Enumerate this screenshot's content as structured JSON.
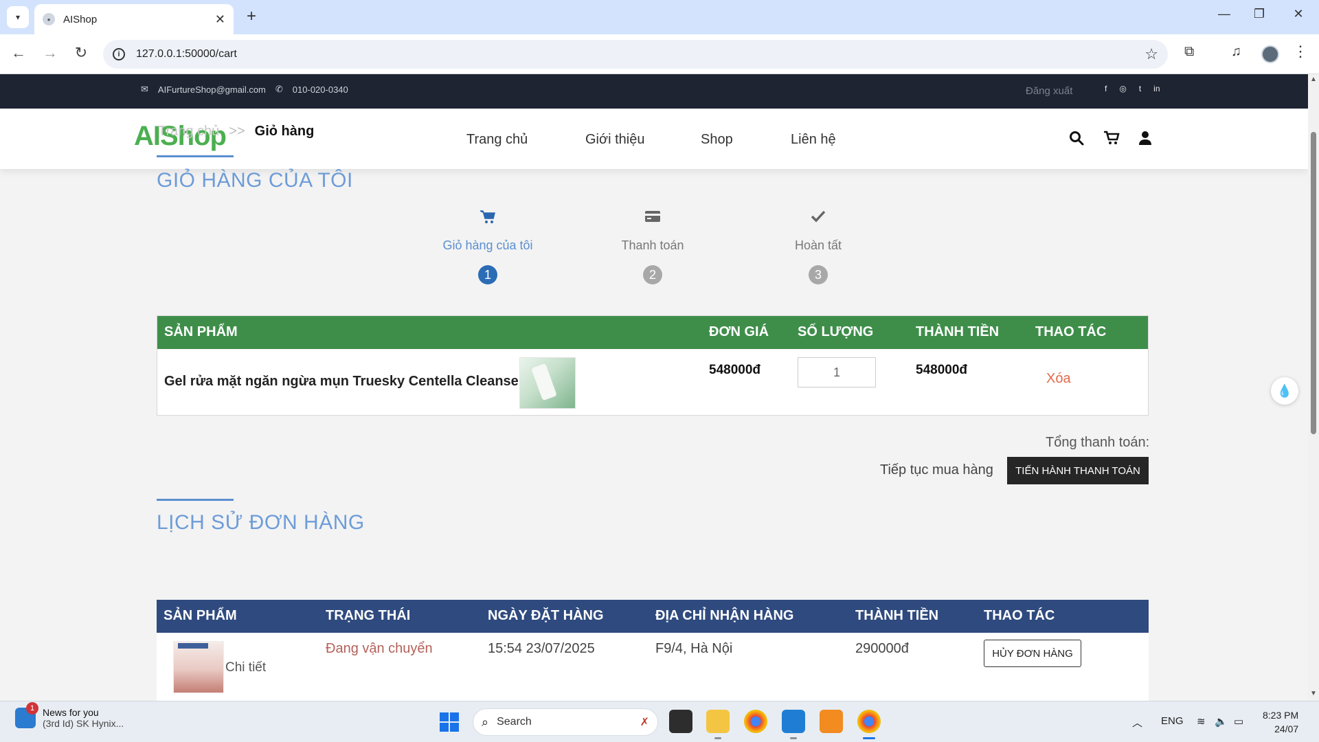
{
  "browser": {
    "tab_title": "AIShop",
    "url": "127.0.0.1:50000/cart",
    "new_tab_symbol": "+",
    "tab_close_symbol": "✕"
  },
  "topbar": {
    "email": "AIFurtureShop@gmail.com",
    "phone": "010-020-0340",
    "logout": "Đăng xuất",
    "social": [
      "f",
      "◎",
      "t",
      "in"
    ]
  },
  "header": {
    "logo": "AIShop",
    "breadcrumb": {
      "home": "Trang chủ",
      "separator": ">>",
      "current": "Giỏ hàng"
    },
    "nav": [
      "Trang chủ",
      "Giới thiệu",
      "Shop",
      "Liên hệ"
    ]
  },
  "cart": {
    "title": "GIỎ HÀNG CỦA TÔI",
    "steps": [
      {
        "label": "Giỏ hàng của tôi",
        "number": "1",
        "icon": "cart-icon"
      },
      {
        "label": "Thanh toán",
        "number": "2",
        "icon": "credit-card-icon"
      },
      {
        "label": "Hoàn tất",
        "number": "3",
        "icon": "check-icon"
      }
    ],
    "columns": [
      "SẢN PHẨM",
      "ĐƠN GIÁ",
      "SỐ LƯỢNG",
      "THÀNH TIỀN",
      "THAO TÁC"
    ],
    "items": [
      {
        "name": "Gel rửa mặt ngăn ngừa mụn Truesky Centella Cleanse...",
        "unit_price": "548000đ",
        "quantity": "1",
        "subtotal": "548000đ",
        "action": "Xóa"
      }
    ],
    "total_label": "Tổng thanh toán:",
    "continue_label": "Tiếp tục mua hàng",
    "checkout_label": "TIẾN HÀNH THANH TOÁN"
  },
  "history": {
    "title": "LỊCH SỬ ĐƠN HÀNG",
    "columns": [
      "SẢN PHẨM",
      "TRẠNG THÁI",
      "NGÀY ĐẶT HÀNG",
      "ĐỊA CHỈ NHẬN HÀNG",
      "THÀNH TIỀN",
      "THAO TÁC"
    ],
    "orders": [
      {
        "detail_label": "Chi tiết",
        "status": "Đang vận chuyển",
        "date": "15:54 23/07/2025",
        "address": "F9/4, Hà Nội",
        "total": "290000đ",
        "action": "HỦY ĐƠN HÀNG"
      }
    ]
  },
  "taskbar": {
    "news_badge": "1",
    "news_title": "News for you",
    "news_sub": "(3rd Id) SK Hynix...",
    "search_placeholder": "Search",
    "language": "ENG",
    "time": "8:23 PM",
    "date": "24/07"
  },
  "colors": {
    "cart_header": "#3e8e4a",
    "history_header": "#2f4a7e",
    "accent_blue": "#2b6cb5",
    "logo_green": "#4caf50",
    "delete_red": "#e06a4a"
  }
}
